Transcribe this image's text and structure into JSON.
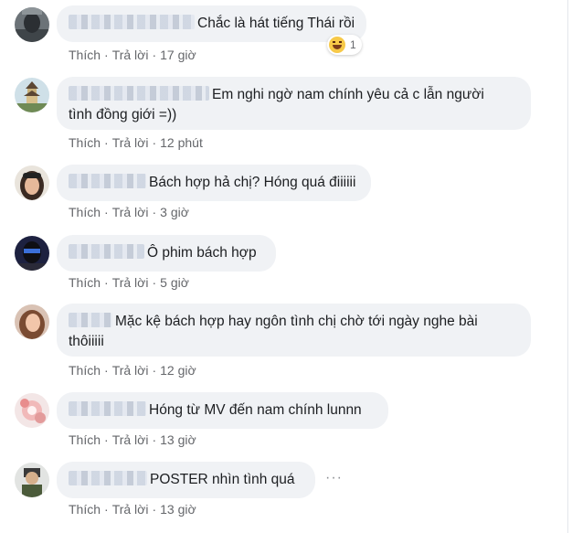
{
  "actions": {
    "like": "Thích",
    "reply": "Trả lời",
    "dot": "·"
  },
  "comments": [
    {
      "text": "Chắc là hát tiếng Thái rồi",
      "time": "17 giờ",
      "reaction_count": "1",
      "reaction_icon": "laugh-emoji-icon"
    },
    {
      "text_line1": "Em nghi ngờ nam chính yêu cả c lẫn người",
      "text_line2": "tình đồng giới =))",
      "time": "12 phút"
    },
    {
      "text": "Bách hợp hả chị? Hóng quá điiiiii",
      "time": "3 giờ"
    },
    {
      "text": "Ô phim bách hợp",
      "time": "5 giờ"
    },
    {
      "text_line1": "Mặc kệ bách hợp hay ngôn tình chị chờ tới ngày nghe bài",
      "text_line2": "thôiiiii",
      "time": "12 giờ"
    },
    {
      "text": "Hóng từ MV đến nam chính lunnn",
      "time": "13 giờ"
    },
    {
      "text": "POSTER nhìn tình quá",
      "time": "13 giờ",
      "more": "···"
    }
  ],
  "colors": {
    "bubble": "#f0f2f5",
    "meta": "#65676b",
    "text": "#1c1e21"
  }
}
